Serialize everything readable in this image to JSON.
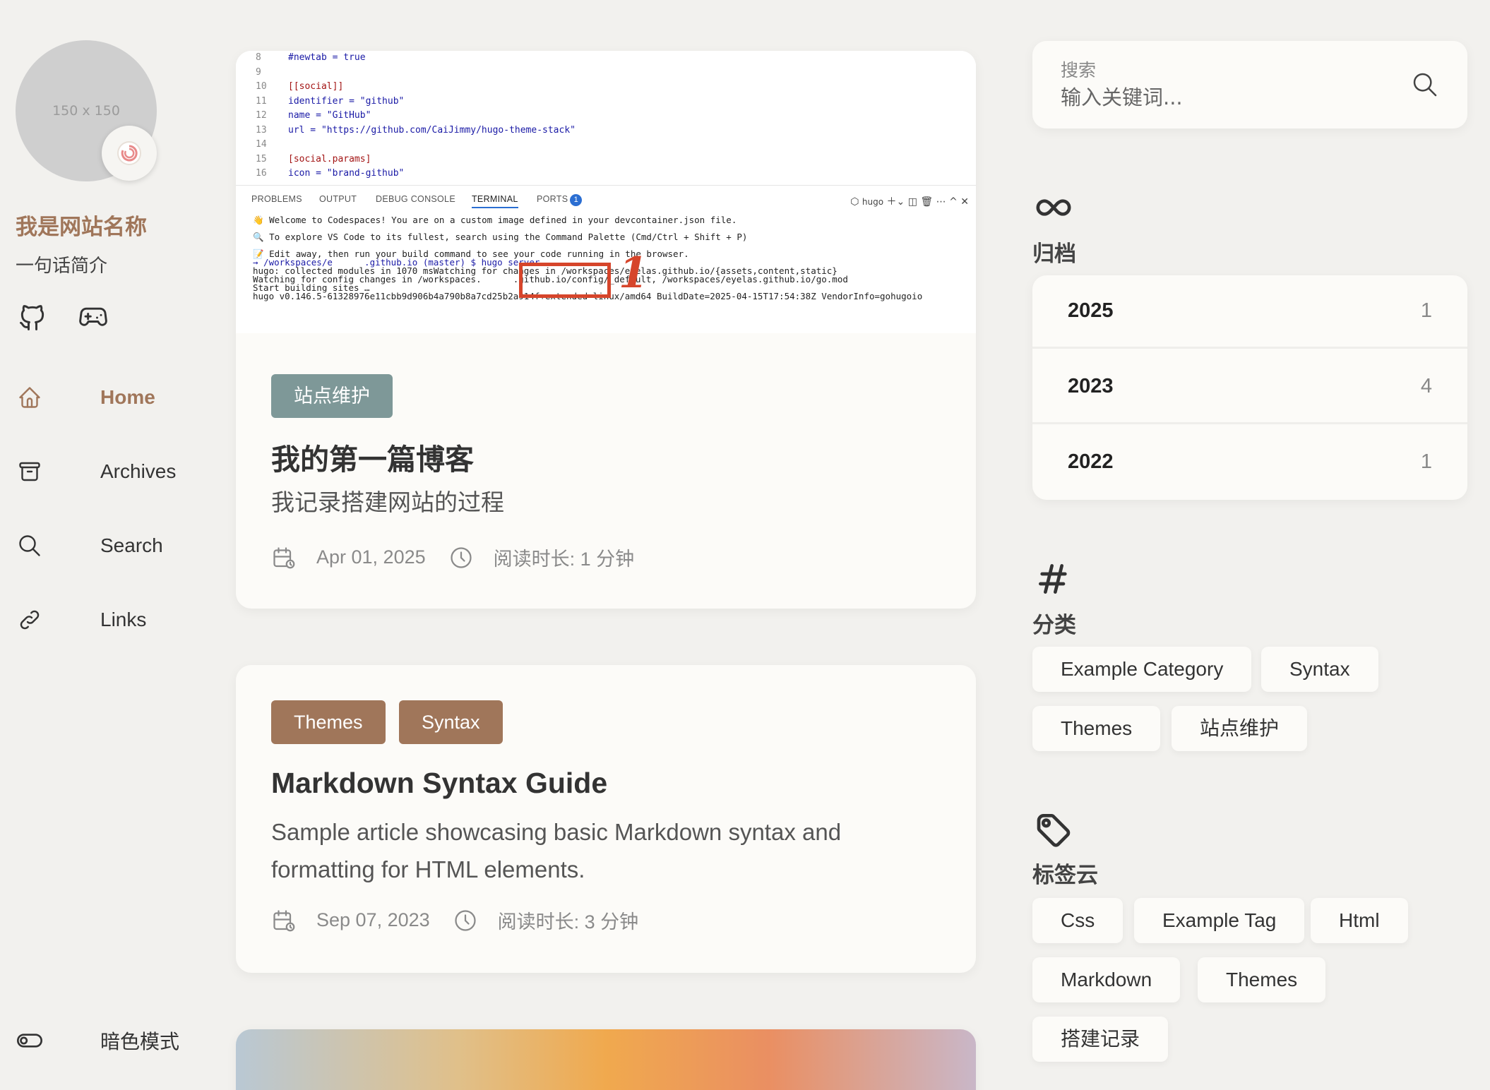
{
  "sidebar": {
    "avatar_placeholder": "150 x 150",
    "site_name": "我是网站名称",
    "site_desc": "一句话简介",
    "menu": [
      {
        "label": "Home",
        "icon": "home-icon",
        "active": true
      },
      {
        "label": "Archives",
        "icon": "archive-icon"
      },
      {
        "label": "Search",
        "icon": "search-icon"
      },
      {
        "label": "Links",
        "icon": "link-icon"
      }
    ],
    "dark_mode_label": "暗色模式"
  },
  "posts": [
    {
      "tags": [
        "站点维护"
      ],
      "title": "我的第一篇博客",
      "subtitle": "我记录搭建网站的过程",
      "date": "Apr 01, 2025",
      "read_time": "阅读时长: 1 分钟",
      "screenshot": {
        "code_lines": [
          {
            "n": "8",
            "t": "#newtab = true"
          },
          {
            "n": "9",
            "t": ""
          },
          {
            "n": "10",
            "t": "[[social]]"
          },
          {
            "n": "11",
            "t": "identifier = \"github\""
          },
          {
            "n": "12",
            "t": "name = \"GitHub\""
          },
          {
            "n": "13",
            "t": "url = \"https://github.com/CaiJimmy/hugo-theme-stack\""
          },
          {
            "n": "14",
            "t": ""
          },
          {
            "n": "15",
            "t": "[social.params]"
          },
          {
            "n": "16",
            "t": "icon = \"brand-github\""
          }
        ],
        "tabs": [
          "PROBLEMS",
          "OUTPUT",
          "DEBUG CONSOLE",
          "TERMINAL",
          "PORTS"
        ],
        "ports_count": "1",
        "terminal_label": "hugo",
        "term_lines": [
          "👋 Welcome to Codespaces! You are on a custom image defined in your devcontainer.json file.",
          "🔍 To explore VS Code to its fullest, search using the Command Palette (Cmd/Ctrl + Shift + P)",
          "📝 Edit away, then run your build command to see your code running in the browser.",
          "→ /workspaces/e      .github.io (master) $ hugo server",
          "hugo: collected modules in 1070 msWatching for changes in /workspaces/eyelas.github.io/{assets,content,static}",
          "Watching for config changes in /workspaces.      .github.io/config/_default, /workspaces/eyelas.github.io/go.mod",
          "Start building sites …",
          "hugo v0.146.5-61328976e11cbb9d906b4a790b8a7cd25b2a914f+extended linux/amd64 BuildDate=2025-04-15T17:54:38Z VendorInfo=gohugoio"
        ],
        "annotation": "1"
      }
    },
    {
      "tags": [
        "Themes",
        "Syntax"
      ],
      "title": "Markdown Syntax Guide",
      "subtitle": "Sample article showcasing basic Markdown syntax and formatting for HTML elements.",
      "date": "Sep 07, 2023",
      "read_time": "阅读时长: 3 分钟"
    }
  ],
  "search": {
    "label": "搜索",
    "placeholder": "输入关键词..."
  },
  "archives": {
    "title": "归档",
    "items": [
      {
        "year": "2025",
        "count": "1"
      },
      {
        "year": "2023",
        "count": "4"
      },
      {
        "year": "2022",
        "count": "1"
      }
    ]
  },
  "categories": {
    "title": "分类",
    "items": [
      "Example Category",
      "Syntax",
      "Themes",
      "站点维护"
    ]
  },
  "tags": {
    "title": "标签云",
    "items": [
      "Css",
      "Example Tag",
      "Html",
      "Markdown",
      "Themes",
      "搭建记录"
    ]
  },
  "colors": {
    "accent": "#a0765a",
    "tag_brown": "#a0765a",
    "tag_slate": "#7e9898",
    "background": "#f2f1ee",
    "card": "#fcfbf8"
  }
}
